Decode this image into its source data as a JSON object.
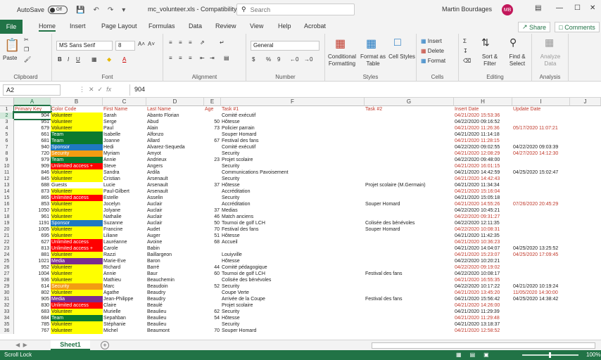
{
  "titlebar": {
    "autosave_label": "AutoSave",
    "autosave_state": "Off",
    "filename": "mc_volunteer.xls - Compatibility Mode",
    "search_placeholder": "Search",
    "user_name": "Martin Bourdages",
    "user_initials": "MB"
  },
  "ribbon_tabs": [
    "File",
    "Home",
    "Insert",
    "Page Layout",
    "Formulas",
    "Data",
    "Review",
    "View",
    "Help",
    "Acrobat"
  ],
  "active_tab": "Home",
  "share_label": "Share",
  "comments_label": "Comments",
  "ribbon": {
    "clipboard": {
      "label": "Clipboard",
      "paste": "Paste"
    },
    "font": {
      "label": "Font",
      "name": "MS Sans Serif",
      "size": "8"
    },
    "alignment": {
      "label": "Alignment"
    },
    "number": {
      "label": "Number",
      "format": "General"
    },
    "styles": {
      "label": "Styles",
      "cond": "Conditional Formatting",
      "table": "Format as Table",
      "cell": "Cell Styles"
    },
    "cells": {
      "label": "Cells",
      "insert": "Insert",
      "delete": "Delete",
      "format": "Format"
    },
    "editing": {
      "label": "Editing",
      "sort": "Sort & Filter",
      "find": "Find & Select"
    },
    "analysis": {
      "label": "Analysis",
      "analyze": "Analyze Data"
    }
  },
  "formula_bar": {
    "cell_ref": "A2",
    "value": "904"
  },
  "columns": [
    "A",
    "B",
    "C",
    "D",
    "E",
    "F",
    "G",
    "H",
    "I",
    "J"
  ],
  "headers": [
    "Primary Key",
    "Color Code",
    "First Name",
    "Last Name",
    "Age",
    "Task #1",
    "Task #2",
    "Insert Date",
    "Update Date"
  ],
  "colors": {
    "volunteer": "#ffff00",
    "team": "#0b7a2e",
    "sponsor": "#1f78c1",
    "security": "#f39c12",
    "unlimited": "#ff0000",
    "guests": "#ffffff",
    "media": "#7b2c91",
    "accent": "#217346"
  },
  "rows": [
    {
      "k": "904",
      "c": "Volunteer",
      "t": "volunteer",
      "f": "Sarah",
      "l": "Abanto Florian",
      "a": "",
      "t1": "Comité exécutif",
      "t2": "",
      "ins": "04/21/2020 15:53:36",
      "upd": "",
      "r": true
    },
    {
      "k": "951",
      "c": "Volunteer",
      "t": "volunteer",
      "f": "Serge",
      "l": "Abud",
      "a": "50",
      "t1": "Hôtesse",
      "t2": "",
      "ins": "04/22/2020 09:16:52",
      "upd": "",
      "r": false
    },
    {
      "k": "679",
      "c": "Volunteer",
      "t": "volunteer",
      "f": "Paul",
      "l": "Alain",
      "a": "73",
      "t1": "Policier parrain",
      "t2": "",
      "ins": "04/21/2020 11:26:36",
      "upd": "05/17/2020 11:07:21",
      "r": true
    },
    {
      "k": "661",
      "c": "Team",
      "t": "team",
      "f": "Isabelle",
      "l": "Alfonzo",
      "a": "",
      "t1": "Souper Homard",
      "t2": "",
      "ins": "04/21/2020 11:14:18",
      "upd": "",
      "r": false
    },
    {
      "k": "681",
      "c": "Team",
      "t": "team",
      "f": "Joanne",
      "l": "Allard",
      "a": "67",
      "t1": "Festival des fans",
      "t2": "",
      "ins": "04/21/2020 11:28:15",
      "upd": "",
      "r": true
    },
    {
      "k": "940",
      "c": "Sponsor",
      "t": "sponsor",
      "f": "Hedi",
      "l": "Alvarez-Sequeda",
      "a": "",
      "t1": "Comité exécutif",
      "t2": "",
      "ins": "04/22/2020 09:02:55",
      "upd": "04/22/2020 09:03:39",
      "r": false
    },
    {
      "k": "720",
      "c": "Security",
      "t": "security",
      "f": "Myriam",
      "l": "Amyot",
      "a": "",
      "t1": "Security",
      "t2": "",
      "ins": "04/21/2020 12:08:29",
      "upd": "04/27/2020 14:12:30",
      "r": true
    },
    {
      "k": "979",
      "c": "Team",
      "t": "team",
      "f": "Annie",
      "l": "Andrieux",
      "a": "23",
      "t1": "Projet scolaire",
      "t2": "",
      "ins": "04/22/2020 09:48:00",
      "upd": "",
      "r": false
    },
    {
      "k": "909",
      "c": "Unlimited access +",
      "t": "unlimited",
      "f": "Steve",
      "l": "Angers",
      "a": "",
      "t1": "Security",
      "t2": "",
      "ins": "04/21/2020 16:01:15",
      "upd": "",
      "r": true
    },
    {
      "k": "846",
      "c": "Volunteer",
      "t": "volunteer",
      "f": "Sandra",
      "l": "Ardila",
      "a": "",
      "t1": "Communications Pavoisement",
      "t2": "",
      "ins": "04/21/2020 14:42:59",
      "upd": "04/25/2020 15:02:47",
      "r": false
    },
    {
      "k": "845",
      "c": "Volunteer",
      "t": "volunteer",
      "f": "Cristian",
      "l": "Arsenault",
      "a": "",
      "t1": "Security",
      "t2": "",
      "ins": "04/21/2020 14:42:43",
      "upd": "",
      "r": true
    },
    {
      "k": "688",
      "c": "Guests",
      "t": "guests",
      "f": "Lucie",
      "l": "Arsenault",
      "a": "37",
      "t1": "Hôtesse",
      "t2": "Projet scolaire (M.Germain)",
      "ins": "04/21/2020 11:34:34",
      "upd": "",
      "r": false
    },
    {
      "k": "873",
      "c": "Volunteer",
      "t": "volunteer",
      "f": "Paul-Gilbert",
      "l": "Arsenault",
      "a": "",
      "t1": "Accréditation",
      "t2": "",
      "ins": "04/21/2020 15:16:04",
      "upd": "",
      "r": true
    },
    {
      "k": "865",
      "c": "Unlimited access",
      "t": "unlimited",
      "f": "Estelle",
      "l": "Asselin",
      "a": "",
      "t1": "Security",
      "t2": "",
      "ins": "04/21/2020 15:05:18",
      "upd": "",
      "r": false
    },
    {
      "k": "853",
      "c": "Volunteer",
      "t": "volunteer",
      "f": "Jocelyn",
      "l": "Auclair",
      "a": "",
      "t1": "Accréditation",
      "t2": "Souper Homard",
      "ins": "04/21/2020 14:55:26",
      "upd": "07/26/2020 20:45:29",
      "r": true
    },
    {
      "k": "1050",
      "c": "Volunteer",
      "t": "volunteer",
      "f": "Jolyane",
      "l": "Auclair",
      "a": "37",
      "t1": "Medias",
      "t2": "",
      "ins": "04/22/2020 10:45:21",
      "upd": "",
      "r": false
    },
    {
      "k": "961",
      "c": "Volunteer",
      "t": "volunteer",
      "f": "Nathalie",
      "l": "Auclair",
      "a": "46",
      "t1": "Match anciens",
      "t2": "",
      "ins": "04/22/2020 09:31:27",
      "upd": "",
      "r": true
    },
    {
      "k": "1191",
      "c": "Sponsor",
      "t": "sponsor",
      "f": "Suzanne",
      "l": "Auclair",
      "a": "50",
      "t1": "Tournoi de golf LCH",
      "t2": "Colisée des bénévoles",
      "ins": "04/22/2020 12:11:35",
      "upd": "",
      "r": false
    },
    {
      "k": "1005",
      "c": "Volunteer",
      "t": "volunteer",
      "f": "Francine",
      "l": "Audet",
      "a": "70",
      "t1": "Festival des fans",
      "t2": "Souper Homard",
      "ins": "04/22/2020 10:08:31",
      "upd": "",
      "r": true
    },
    {
      "k": "695",
      "c": "Volunteer",
      "t": "volunteer",
      "f": "Liliane",
      "l": "Auger",
      "a": "51",
      "t1": "Hôtesse",
      "t2": "",
      "ins": "04/21/2020 11:42:35",
      "upd": "",
      "r": false
    },
    {
      "k": "627",
      "c": "Unlimited access",
      "t": "unlimited",
      "f": "Lauréanne",
      "l": "Avoine",
      "a": "68",
      "t1": "Accueil",
      "t2": "",
      "ins": "04/21/2020 10:36:23",
      "upd": "",
      "r": true
    },
    {
      "k": "813",
      "c": "Unlimited access +",
      "t": "unlimited",
      "f": "Carole",
      "l": "Babin",
      "a": "",
      "t1": "",
      "t2": "",
      "ins": "04/21/2020 14:04:07",
      "upd": "04/25/2020 13:25:52",
      "r": false
    },
    {
      "k": "881",
      "c": "Volunteer",
      "t": "volunteer",
      "f": "Razzi",
      "l": "Baillargeon",
      "a": "",
      "t1": "Louiyville",
      "t2": "",
      "ins": "04/21/2020 15:23:07",
      "upd": "04/25/2020 17:09:45",
      "r": true
    },
    {
      "k": "1021",
      "c": "Media",
      "t": "media",
      "f": "Marie-Eve",
      "l": "Baron",
      "a": "",
      "t1": "Hôtesse",
      "t2": "",
      "ins": "04/22/2020 10:20:21",
      "upd": "",
      "r": false
    },
    {
      "k": "952",
      "c": "Volunteer",
      "t": "volunteer",
      "f": "Richard",
      "l": "Barré",
      "a": "44",
      "t1": "Comité pédagogique",
      "t2": "",
      "ins": "04/22/2020 09:19:02",
      "upd": "",
      "r": true
    },
    {
      "k": "1004",
      "c": "Volunteer",
      "t": "volunteer",
      "f": "Annie",
      "l": "Baur",
      "a": "60",
      "t1": "Tournoi de golf LCH",
      "t2": "Festival des fans",
      "ins": "04/22/2020 10:08:17",
      "upd": "",
      "r": false
    },
    {
      "k": "936",
      "c": "Volunteer",
      "t": "volunteer",
      "f": "Mathieu",
      "l": "Beauchemin",
      "a": "",
      "t1": "Colisée des bénévoles",
      "t2": "",
      "ins": "04/21/2020 16:55:35",
      "upd": "",
      "r": true
    },
    {
      "k": "614",
      "c": "Security",
      "t": "security",
      "f": "Marc",
      "l": "Beaudoin",
      "a": "52",
      "t1": "Security",
      "t2": "",
      "ins": "04/22/2020 10:17:22",
      "upd": "04/21/2020 10:19:24",
      "r": false
    },
    {
      "k": "802",
      "c": "Volunteer",
      "t": "volunteer",
      "f": "Agathe",
      "l": "Beaudry",
      "a": "",
      "t1": "Coupe Verte",
      "t2": "",
      "ins": "04/21/2020 13:45:20",
      "upd": "11/05/2020 14:30:00",
      "r": true
    },
    {
      "k": "905",
      "c": "Media",
      "t": "media",
      "f": "Jean-Philippe",
      "l": "Beaudry",
      "a": "",
      "t1": "Arrivée de la Coupe",
      "t2": "Festival des fans",
      "ins": "04/21/2020 15:56:42",
      "upd": "04/25/2020 14:38:42",
      "r": false
    },
    {
      "k": "830",
      "c": "Unlimited access",
      "t": "unlimited",
      "f": "Claire",
      "l": "Beaulé",
      "a": "",
      "t1": "Projet scolaire",
      "t2": "",
      "ins": "04/21/2020 14:26:00",
      "upd": "",
      "r": true
    },
    {
      "k": "683",
      "c": "Volunteer",
      "t": "volunteer",
      "f": "Murielle",
      "l": "Beaulieu",
      "a": "62",
      "t1": "Security",
      "t2": "",
      "ins": "04/21/2020 11:29:39",
      "upd": "",
      "r": false
    },
    {
      "k": "684",
      "c": "Team",
      "t": "team",
      "f": "Sepahban",
      "l": "Beaulieu",
      "a": "54",
      "t1": "Hôtesse",
      "t2": "",
      "ins": "04/21/2020 11:29:48",
      "upd": "",
      "r": true
    },
    {
      "k": "785",
      "c": "Volunteer",
      "t": "volunteer",
      "f": "Stéphanie",
      "l": "Beaulieu",
      "a": "",
      "t1": "Security",
      "t2": "",
      "ins": "04/21/2020 13:18:37",
      "upd": "",
      "r": false
    },
    {
      "k": "767",
      "c": "Volunteer",
      "t": "volunteer",
      "f": "Michel",
      "l": "Beaumont",
      "a": "70",
      "t1": "Souper Homard",
      "t2": "",
      "ins": "04/21/2020 12:58:52",
      "upd": "",
      "r": true
    }
  ],
  "sheet_tab": "Sheet1",
  "status": {
    "left": "Scroll Lock",
    "zoom": "100%"
  }
}
